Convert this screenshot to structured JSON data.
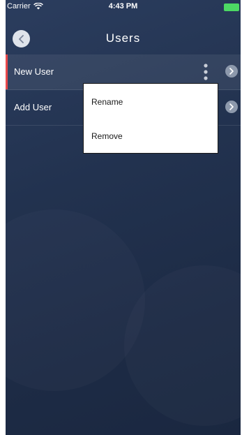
{
  "status_bar": {
    "carrier": "Carrier",
    "time": "4:43 PM"
  },
  "nav": {
    "title": "Users",
    "back_icon": "chevron-left-icon"
  },
  "rows": [
    {
      "label": "New User",
      "selected": true
    },
    {
      "label": "Add User",
      "selected": false
    }
  ],
  "context_menu": {
    "items": [
      "Rename",
      "Remove"
    ]
  },
  "colors": {
    "selection_accent": "#e8484a",
    "background": "#22324f",
    "battery": "#4cd964"
  }
}
